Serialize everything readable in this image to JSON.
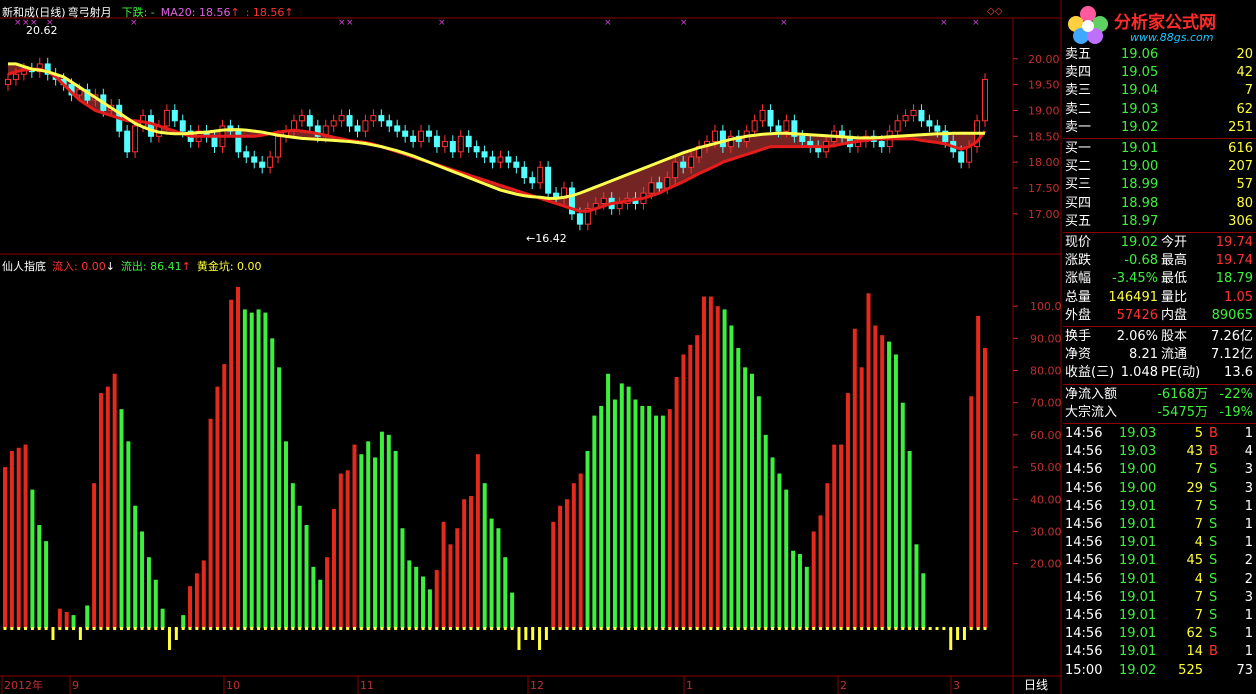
{
  "header": {
    "stock_title": "新和成(日线)",
    "indicator_name": "弯弓射月",
    "fall_label": "下跌: -",
    "ma20_label": "MA20: 18.56",
    "ma20_arrow": "↑",
    "last_value": ": 18.56",
    "last_arrow": "↑"
  },
  "price_annotations": {
    "high": "20.62",
    "low": "←16.42"
  },
  "indicator_header": {
    "name": "仙人指底",
    "inflow": "流入: 0.00",
    "inflow_arrow": "↓",
    "outflow": "流出: 86.41",
    "outflow_arrow": "↑",
    "gold_pit": "黄金坑: 0.00"
  },
  "price_axis": [
    "20.00",
    "19.50",
    "19.00",
    "18.50",
    "18.00",
    "17.50",
    "17.00"
  ],
  "indicator_axis": [
    "100.0",
    "90.00",
    "80.00",
    "70.00",
    "60.00",
    "50.00",
    "40.00",
    "30.00",
    "20.00"
  ],
  "time_axis": [
    "2012年",
    "9",
    "10",
    "11",
    "12",
    "1",
    "2",
    "3"
  ],
  "period_label": "日线",
  "logo": {
    "title": "分析家公式网",
    "url": "www.88gs.com"
  },
  "colors": {
    "up": "#ff3232",
    "down": "#54ffff",
    "red_bar": "#e42a1c",
    "green_bar": "#3ef03e",
    "yellow": "#ffff3c",
    "ma": "#ffff50",
    "grid": "#8a0000"
  },
  "order_book": {
    "asks": [
      {
        "label": "卖五",
        "price": "19.06",
        "vol": "20"
      },
      {
        "label": "卖四",
        "price": "19.05",
        "vol": "42"
      },
      {
        "label": "卖三",
        "price": "19.04",
        "vol": "7"
      },
      {
        "label": "卖二",
        "price": "19.03",
        "vol": "62"
      },
      {
        "label": "卖一",
        "price": "19.02",
        "vol": "251"
      }
    ],
    "bids": [
      {
        "label": "买一",
        "price": "19.01",
        "vol": "616"
      },
      {
        "label": "买二",
        "price": "19.00",
        "vol": "207"
      },
      {
        "label": "买三",
        "price": "18.99",
        "vol": "57"
      },
      {
        "label": "买四",
        "price": "18.98",
        "vol": "80"
      },
      {
        "label": "买五",
        "price": "18.97",
        "vol": "306"
      }
    ]
  },
  "quote": [
    {
      "l1": "现价",
      "v1": "19.02",
      "c1": "#3ef03e",
      "l2": "今开",
      "v2": "19.74",
      "c2": "#ff3232"
    },
    {
      "l1": "涨跌",
      "v1": "-0.68",
      "c1": "#3ef03e",
      "l2": "最高",
      "v2": "19.74",
      "c2": "#ff3232"
    },
    {
      "l1": "涨幅",
      "v1": "-3.45%",
      "c1": "#3ef03e",
      "l2": "最低",
      "v2": "18.79",
      "c2": "#3ef03e"
    },
    {
      "l1": "总量",
      "v1": "146491",
      "c1": "#ffff3c",
      "l2": "量比",
      "v2": "1.05",
      "c2": "#ff3232"
    },
    {
      "l1": "外盘",
      "v1": "57426",
      "c1": "#ff3232",
      "l2": "内盘",
      "v2": "89065",
      "c2": "#3ef03e"
    }
  ],
  "fundamentals": [
    {
      "l1": "换手",
      "v1": "2.06%",
      "l2": "股本",
      "v2": "7.26亿"
    },
    {
      "l1": "净资",
      "v1": "8.21",
      "l2": "流通",
      "v2": "7.12亿"
    },
    {
      "l1": "收益(三)",
      "v1": "1.048",
      "l2": "PE(动)",
      "v2": "13.6"
    }
  ],
  "flows": [
    {
      "label": "净流入额",
      "v1": "-6168万",
      "v2": "-22%"
    },
    {
      "label": "大宗流入",
      "v1": "-5475万",
      "v2": "-19%"
    }
  ],
  "ticks": [
    {
      "time": "14:56",
      "price": "19.03",
      "pc": "#3ef03e",
      "vol": "5",
      "side": "B",
      "n": "1"
    },
    {
      "time": "14:56",
      "price": "19.03",
      "pc": "#3ef03e",
      "vol": "43",
      "side": "B",
      "n": "4"
    },
    {
      "time": "14:56",
      "price": "19.00",
      "pc": "#3ef03e",
      "vol": "7",
      "side": "S",
      "n": "3"
    },
    {
      "time": "14:56",
      "price": "19.00",
      "pc": "#3ef03e",
      "vol": "29",
      "side": "S",
      "n": "3"
    },
    {
      "time": "14:56",
      "price": "19.01",
      "pc": "#3ef03e",
      "vol": "7",
      "side": "S",
      "n": "1"
    },
    {
      "time": "14:56",
      "price": "19.01",
      "pc": "#3ef03e",
      "vol": "7",
      "side": "S",
      "n": "1"
    },
    {
      "time": "14:56",
      "price": "19.01",
      "pc": "#3ef03e",
      "vol": "4",
      "side": "S",
      "n": "1"
    },
    {
      "time": "14:56",
      "price": "19.01",
      "pc": "#3ef03e",
      "vol": "45",
      "side": "S",
      "n": "2"
    },
    {
      "time": "14:56",
      "price": "19.01",
      "pc": "#3ef03e",
      "vol": "4",
      "side": "S",
      "n": "2"
    },
    {
      "time": "14:56",
      "price": "19.01",
      "pc": "#3ef03e",
      "vol": "7",
      "side": "S",
      "n": "3"
    },
    {
      "time": "14:56",
      "price": "19.01",
      "pc": "#3ef03e",
      "vol": "7",
      "side": "S",
      "n": "1"
    },
    {
      "time": "14:56",
      "price": "19.01",
      "pc": "#3ef03e",
      "vol": "62",
      "side": "S",
      "n": "1"
    },
    {
      "time": "14:56",
      "price": "19.01",
      "pc": "#3ef03e",
      "vol": "14",
      "side": "B",
      "n": "1"
    },
    {
      "time": "15:00",
      "price": "19.02",
      "pc": "#3ef03e",
      "vol": "525",
      "side": "",
      "n": "73"
    }
  ],
  "chart_data": [
    {
      "type": "line",
      "name": "candlestick price",
      "ylim": [
        16.42,
        20.62
      ],
      "ma20_value": 18.56,
      "close": [
        19.6,
        19.7,
        19.8,
        19.75,
        19.9,
        19.7,
        19.6,
        19.5,
        19.3,
        19.4,
        19.2,
        19.3,
        19.0,
        19.1,
        18.6,
        18.2,
        18.7,
        18.9,
        18.5,
        18.7,
        19.0,
        18.8,
        18.6,
        18.4,
        18.6,
        18.5,
        18.3,
        18.7,
        18.6,
        18.2,
        18.1,
        18.0,
        17.9,
        18.1,
        18.5,
        18.6,
        18.8,
        18.9,
        18.7,
        18.5,
        18.7,
        18.8,
        18.9,
        18.7,
        18.6,
        18.8,
        18.9,
        18.8,
        18.7,
        18.6,
        18.5,
        18.4,
        18.6,
        18.5,
        18.3,
        18.4,
        18.2,
        18.5,
        18.3,
        18.2,
        18.1,
        18.0,
        18.1,
        18.0,
        17.9,
        17.7,
        17.6,
        17.9,
        17.4,
        17.3,
        17.5,
        17.0,
        16.8,
        17.1,
        17.2,
        17.3,
        17.1,
        17.2,
        17.3,
        17.2,
        17.4,
        17.6,
        17.5,
        17.7,
        18.0,
        17.9,
        18.1,
        18.3,
        18.4,
        18.6,
        18.3,
        18.5,
        18.4,
        18.6,
        18.8,
        19.0,
        18.7,
        18.6,
        18.8,
        18.5,
        18.4,
        18.3,
        18.2,
        18.4,
        18.6,
        18.5,
        18.3,
        18.4,
        18.5,
        18.4,
        18.3,
        18.6,
        18.8,
        18.9,
        19.0,
        18.8,
        18.7,
        18.6,
        18.4,
        18.2,
        18.0,
        18.3,
        18.8,
        19.6
      ],
      "ma20": [
        19.9,
        19.9,
        19.85,
        19.8,
        19.78,
        19.75,
        19.7,
        19.65,
        19.55,
        19.45,
        19.35,
        19.25,
        19.15,
        19.05,
        18.95,
        18.85,
        18.75,
        18.68,
        18.62,
        18.58,
        18.56,
        18.55,
        18.55,
        18.56,
        18.57,
        18.58,
        18.6,
        18.62,
        18.63,
        18.63,
        18.62,
        18.6,
        18.58,
        18.55,
        18.52,
        18.5,
        18.48,
        18.46,
        18.45,
        18.44,
        18.43,
        18.42,
        18.41,
        18.4,
        18.38,
        18.36,
        18.33,
        18.3,
        18.26,
        18.22,
        18.17,
        18.12,
        18.06,
        18.0,
        17.94,
        17.88,
        17.82,
        17.76,
        17.7,
        17.64,
        17.58,
        17.52,
        17.46,
        17.42,
        17.38,
        17.35,
        17.33,
        17.32,
        17.3,
        17.3,
        17.32,
        17.35,
        17.4,
        17.46,
        17.52,
        17.58,
        17.64,
        17.7,
        17.76,
        17.82,
        17.88,
        17.94,
        18.0,
        18.06,
        18.12,
        18.18,
        18.23,
        18.28,
        18.32,
        18.36,
        18.4,
        18.44,
        18.47,
        18.5,
        18.52,
        18.54,
        18.55,
        18.56,
        18.56,
        18.55,
        18.54,
        18.53,
        18.52,
        18.51,
        18.5,
        18.49,
        18.48,
        18.47,
        18.47,
        18.47,
        18.48,
        18.49,
        18.5,
        18.51,
        18.52,
        18.53,
        18.54,
        18.55,
        18.55,
        18.56,
        18.56,
        18.56,
        18.56,
        18.56
      ],
      "red_line": [
        19.7,
        19.75,
        19.78,
        19.8,
        19.8,
        19.75,
        19.65,
        19.5,
        19.35,
        19.2,
        19.1,
        19.0,
        18.95,
        18.9,
        18.85,
        18.8,
        18.8,
        18.78,
        18.75,
        18.7,
        18.65,
        18.6,
        18.55,
        18.5,
        18.5,
        18.5,
        18.5,
        18.5,
        18.5,
        18.5,
        18.5,
        18.5,
        18.52,
        18.55,
        18.58,
        18.6,
        18.62,
        18.6,
        18.58,
        18.55,
        18.52,
        18.48,
        18.45,
        18.42,
        18.4,
        18.38,
        18.35,
        18.3,
        18.25,
        18.2,
        18.15,
        18.1,
        18.05,
        18.0,
        17.95,
        17.9,
        17.85,
        17.8,
        17.75,
        17.7,
        17.65,
        17.6,
        17.55,
        17.5,
        17.45,
        17.4,
        17.35,
        17.3,
        17.25,
        17.2,
        17.15,
        17.1,
        17.05,
        17.05,
        17.1,
        17.15,
        17.2,
        17.22,
        17.25,
        17.28,
        17.3,
        17.35,
        17.4,
        17.48,
        17.55,
        17.62,
        17.7,
        17.78,
        17.85,
        17.92,
        18.0,
        18.05,
        18.1,
        18.15,
        18.2,
        18.25,
        18.3,
        18.3,
        18.3,
        18.3,
        18.3,
        18.3,
        18.3,
        18.3,
        18.32,
        18.35,
        18.38,
        18.4,
        18.42,
        18.45,
        18.45,
        18.45,
        18.45,
        18.45,
        18.45,
        18.42,
        18.4,
        18.38,
        18.35,
        18.3,
        18.25,
        18.3,
        18.4,
        18.6
      ]
    },
    {
      "type": "bar",
      "name": "仙人指底",
      "ylim": [
        0,
        110
      ],
      "values": [
        50,
        55,
        56,
        57,
        43,
        32,
        27,
        0,
        6,
        5,
        4,
        0,
        7,
        45,
        73,
        75,
        79,
        68,
        58,
        38,
        30,
        22,
        15,
        6,
        0,
        0,
        4,
        13,
        17,
        21,
        65,
        75,
        82,
        102,
        106,
        99,
        98,
        99,
        98,
        90,
        81,
        58,
        45,
        38,
        32,
        19,
        15,
        22,
        37,
        48,
        49,
        57,
        54,
        58,
        53,
        61,
        60,
        55,
        31,
        21,
        19,
        16,
        12,
        18,
        33,
        26,
        31,
        40,
        41,
        54,
        45,
        34,
        31,
        22,
        11,
        0,
        0,
        0,
        0,
        0,
        33,
        38,
        40,
        45,
        48,
        55,
        66,
        69,
        79,
        71,
        76,
        75,
        71,
        69,
        69,
        66,
        66,
        68,
        78,
        85,
        88,
        91,
        103,
        103,
        100,
        99,
        94,
        87,
        81,
        79,
        72,
        60,
        53,
        48,
        43,
        24,
        23,
        19,
        30,
        35,
        45,
        57,
        57,
        73,
        93,
        81,
        104,
        94,
        91,
        89,
        85,
        70,
        55,
        26,
        17,
        0,
        0,
        0,
        6,
        20,
        40,
        72,
        97,
        87
      ],
      "colors": "r,r,r,r,g,g,g,y,r,r,g,y,g,r,r,r,r,g,g,g,g,g,g,g,y,y,g,r,r,r,r,r,r,r,r,g,g,g,g,g,g,g,g,g,g,g,g,r,r,r,r,r,g,g,g,g,g,g,g,g,g,g,g,r,r,r,r,r,r,r,g,g,g,g,g,y,y,y,y,y,r,r,r,r,r,g,g,g,g,g,g,g,g,g,g,g,g,r,r,r,r,r,r,r,r,g,g,g,g,g,g,g,g,g,g,g,g,g,r,r,r,r,r,r,r,r,r,r,r,g,g,g,g,g,g,g,g,g,y,y,y,r,r,r,r,r,g",
      "gold_pit": [
        0,
        0,
        0,
        0,
        0,
        0,
        0,
        0,
        0,
        0,
        0,
        0,
        0,
        0,
        0,
        0,
        0,
        0,
        0,
        0,
        0,
        0,
        0,
        0,
        0,
        0,
        0,
        0,
        0,
        0,
        0,
        0,
        0,
        0,
        0,
        0,
        0,
        0,
        0,
        0,
        0,
        0,
        0,
        0,
        0,
        0,
        0,
        0,
        0,
        0,
        0,
        0,
        0,
        0,
        0,
        0,
        0,
        0,
        0,
        0,
        0,
        0,
        0,
        0,
        0,
        0,
        0,
        0,
        0,
        0,
        0,
        0,
        0,
        0,
        0,
        0,
        0,
        0,
        0,
        0,
        0,
        0,
        0,
        0,
        0,
        0,
        0,
        0,
        0,
        0,
        0,
        0,
        0,
        0,
        0,
        0,
        0,
        0,
        0,
        0,
        0,
        0,
        0,
        0,
        0,
        0,
        0,
        0,
        0,
        0,
        0,
        0,
        0,
        0,
        0,
        0,
        0,
        0,
        0,
        0,
        0,
        0,
        0,
        0,
        0,
        0,
        0,
        0,
        0,
        0,
        0,
        0,
        0,
        0,
        0,
        0,
        0,
        0,
        0,
        0,
        0,
        0,
        0,
        0,
        0,
        0,
        0,
        0
      ]
    }
  ]
}
